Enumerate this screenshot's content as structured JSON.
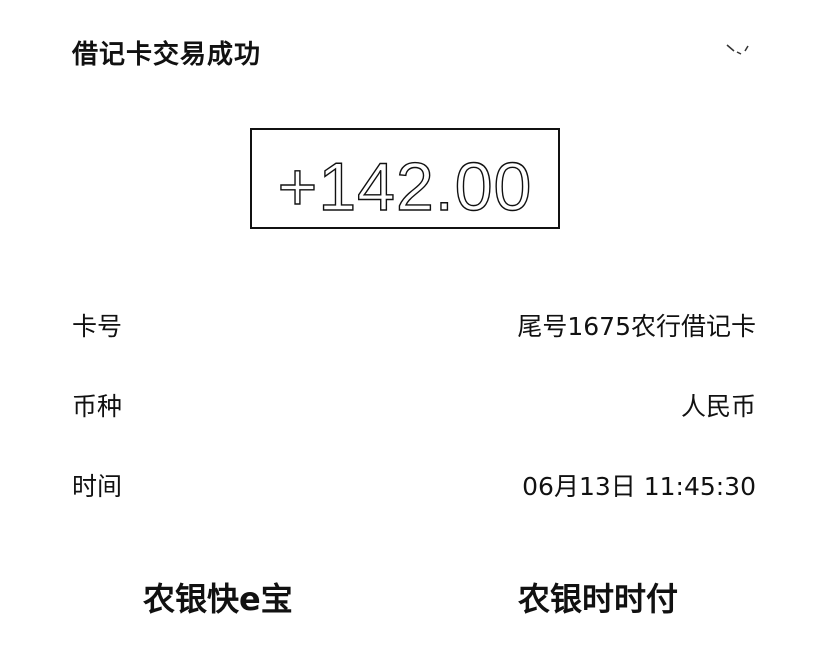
{
  "header": {
    "title": "借记卡交易成功",
    "more_icon": "more-chevron-icon"
  },
  "transaction": {
    "amount": "+142.00"
  },
  "details": [
    {
      "label": "卡号",
      "value": "尾号1675农行借记卡"
    },
    {
      "label": "币种",
      "value": "人民币"
    },
    {
      "label": "时间",
      "value": "06月13日 11:45:30"
    }
  ],
  "footer": {
    "left_link": "农银快e宝",
    "right_link": "农银时时付"
  }
}
